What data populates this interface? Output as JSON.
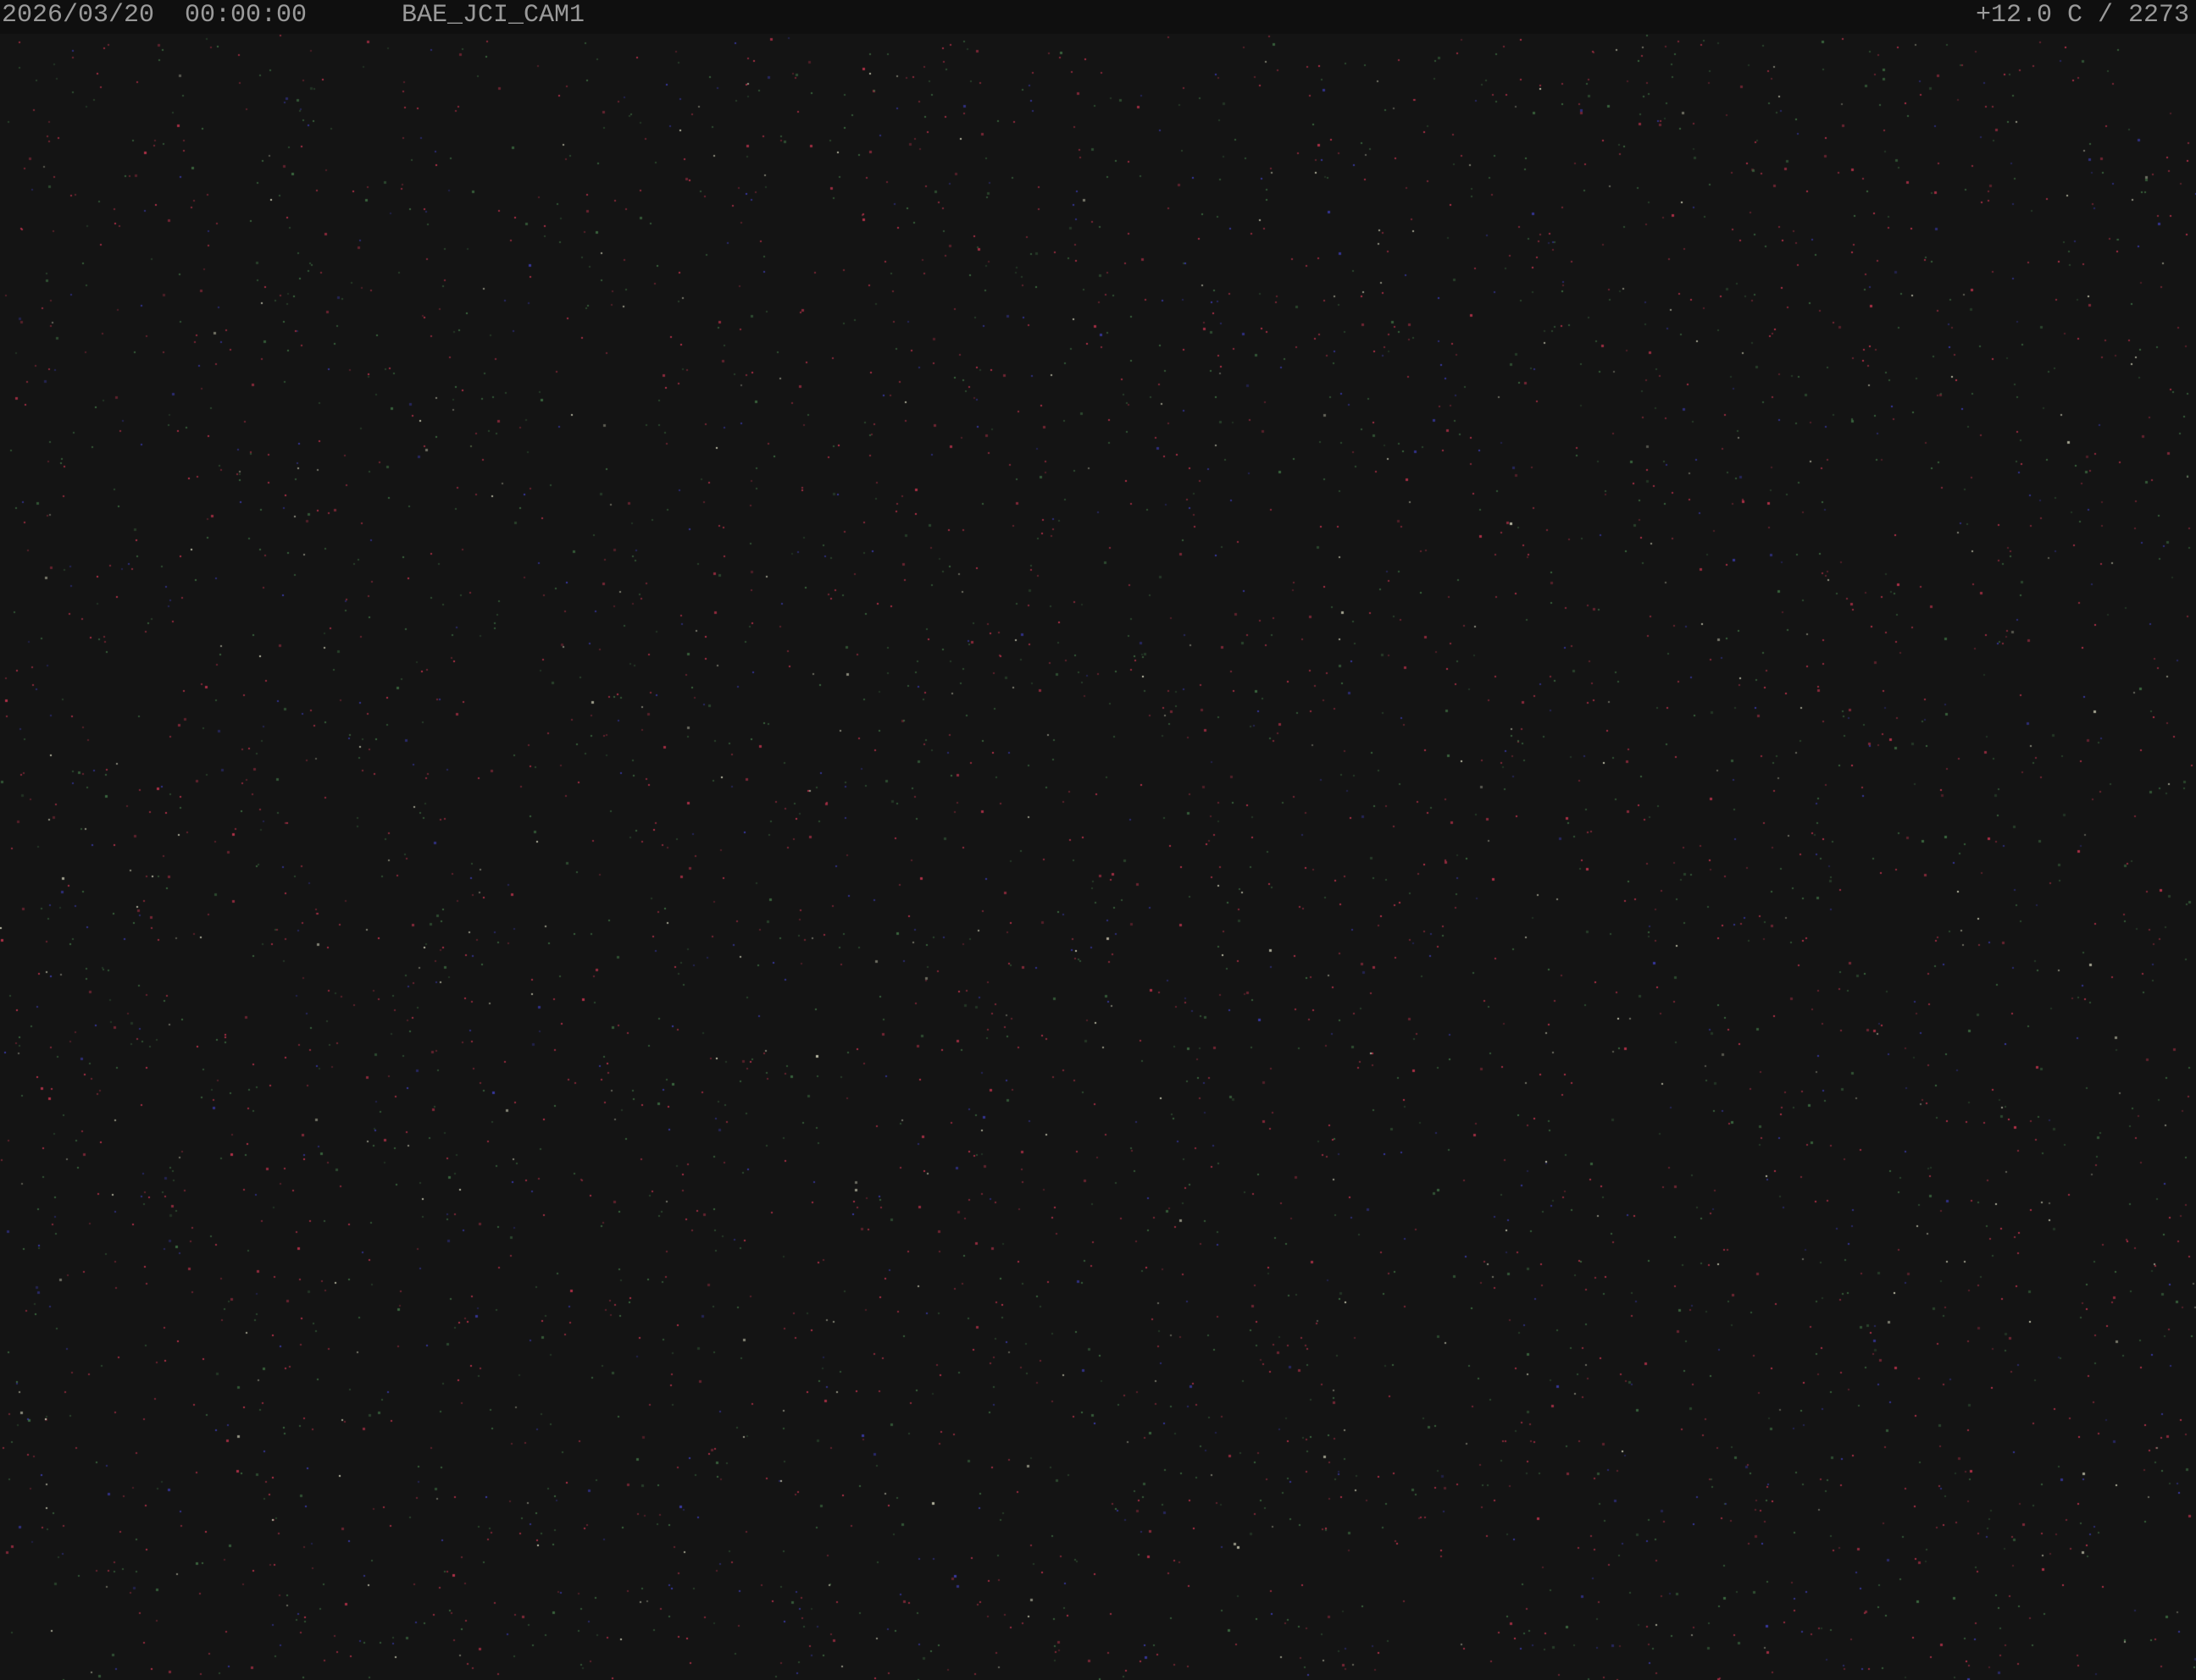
{
  "overlay": {
    "datetime": "2026/03/20  00:00:00",
    "camera_name": "BAE_JCI_CAM1",
    "status": "+12.0 C / 2273"
  },
  "colors": {
    "sky_background": "#141414",
    "overlay_bar": "#0f0f0f",
    "overlay_text": "#9a9a9a",
    "star_red": "#b8324a",
    "star_green": "#3c6a40",
    "star_blue": "#3a3aa8",
    "star_white": "#c8c8b0"
  }
}
